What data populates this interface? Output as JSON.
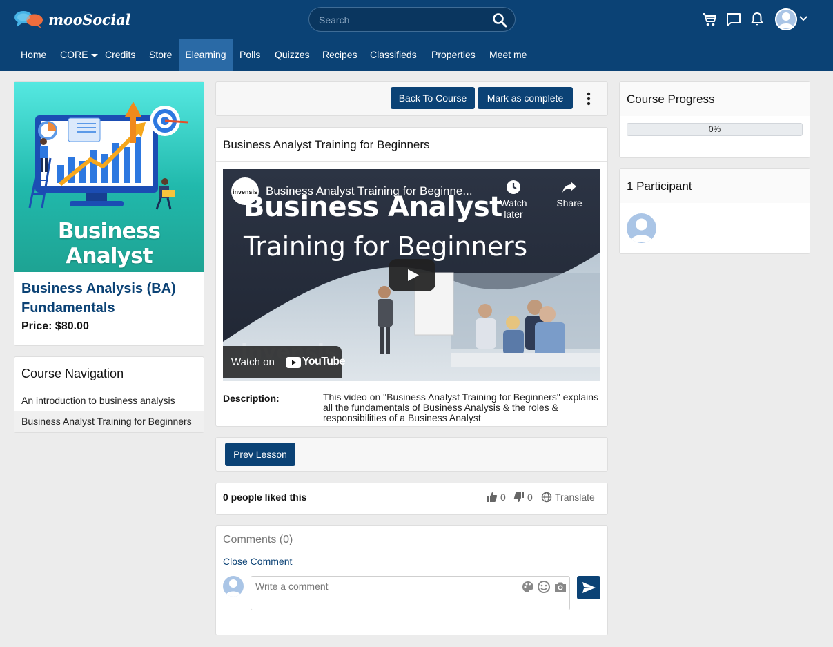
{
  "brand": {
    "name": "mooSocial"
  },
  "search": {
    "placeholder": "Search"
  },
  "nav": {
    "items": [
      "Home",
      "CORE",
      "Credits",
      "Store",
      "Elearning",
      "Polls",
      "Quizzes",
      "Recipes",
      "Classifieds",
      "Properties",
      "Meet me"
    ],
    "active": "Elearning"
  },
  "course": {
    "image_text": "Business Analyst",
    "name": "Business Analysis (BA) Fundamentals",
    "price": "Price: $80.00"
  },
  "course_navigation": {
    "title": "Course Navigation",
    "items": [
      "An introduction to business analysis",
      "Business Analyst Training for Beginners"
    ]
  },
  "toolbar": {
    "back_label": "Back To Course",
    "complete_label": "Mark as complete"
  },
  "lesson": {
    "title": "Business Analyst Training for Beginners",
    "video": {
      "channel_logo_text": "invensis",
      "title": "Business Analyst Training for Beginne...",
      "watch_later": "Watch later",
      "share": "Share",
      "headline_1": "Business Analyst",
      "headline_2": "Training for Beginners",
      "watermark": "invensis",
      "watch_on": "Watch on",
      "youtube": "YouTube"
    },
    "description_label": "Description:",
    "description": "This video on \"Business Analyst Training for Beginners\" explains all the fundamentals of Business Analysis & the roles & responsibilities of a Business Analyst"
  },
  "pager": {
    "prev_label": "Prev Lesson"
  },
  "likes": {
    "summary": "0 people liked this",
    "like_count": "0",
    "dislike_count": "0",
    "translate": "Translate"
  },
  "comments": {
    "title": "Comments (0)",
    "close_label": "Close Comment",
    "placeholder": "Write a comment"
  },
  "progress": {
    "title": "Course Progress",
    "percent_label": "0%",
    "value": 0
  },
  "participants": {
    "title": "1 Participant"
  },
  "colors": {
    "primary": "#0b4275",
    "active_nav": "#2a6aa6",
    "background": "#ececec"
  }
}
